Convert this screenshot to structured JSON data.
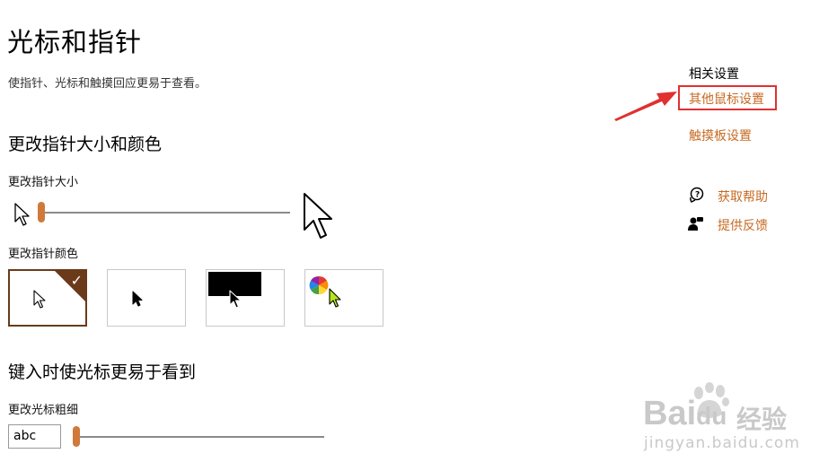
{
  "page": {
    "title": "光标和指针",
    "description": "使指针、光标和触摸回应更易于查看。"
  },
  "pointer_size": {
    "heading": "更改指针大小和颜色",
    "size_label": "更改指针大小",
    "size_level": 0.0
  },
  "pointer_color": {
    "label": "更改指针颜色",
    "options": [
      "white",
      "black",
      "inverted",
      "custom"
    ],
    "selected": "white"
  },
  "cursor": {
    "heading": "键入时使光标更易于看到",
    "thickness_label": "更改光标粗细",
    "preview_text": "abc",
    "thickness_level": 0.0
  },
  "related": {
    "title": "相关设置",
    "links": [
      "其他鼠标设置",
      "触摸板设置"
    ]
  },
  "help": {
    "get_help": "获取帮助",
    "feedback": "提供反馈"
  },
  "watermark": {
    "brand": "Bai",
    "brand_suffix": "du",
    "cn": "经验",
    "url": "jingyan.baidu.com"
  },
  "colors": {
    "accent": "#cf7a3b",
    "link": "#c76a23",
    "selected_border": "#6b3a1a",
    "annotation_red": "#e03030"
  }
}
